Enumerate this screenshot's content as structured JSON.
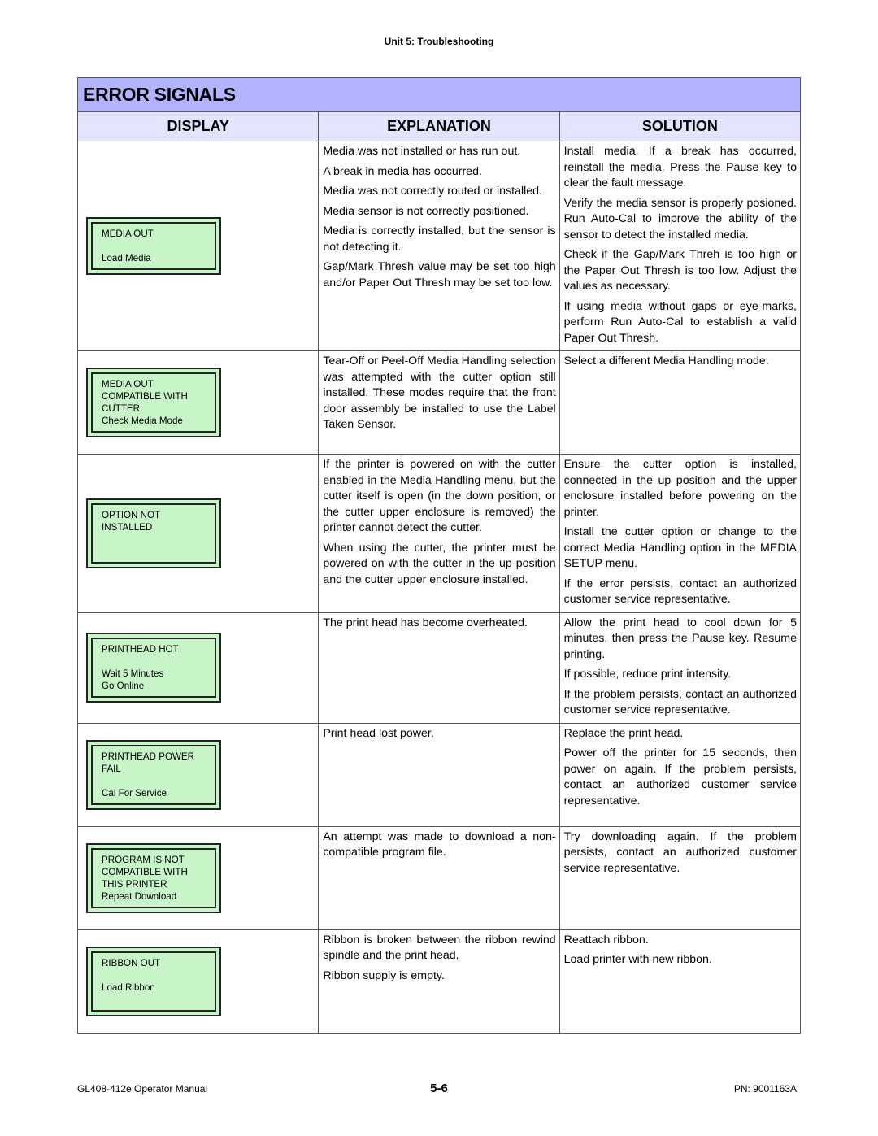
{
  "header": {
    "running_head": "Unit 5:  Troubleshooting"
  },
  "table": {
    "title": "ERROR SIGNALS",
    "columns": {
      "display": "DISPLAY",
      "explanation": "EXPLANATION",
      "solution": "SOLUTION"
    },
    "rows": [
      {
        "display": [
          "MEDIA OUT",
          "",
          "Load Media"
        ],
        "explanation": [
          "Media was not installed or has run out.",
          "A break in media has occurred.",
          "Media was not correctly routed or installed.",
          "Media sensor is not correctly positioned.",
          "Media is correctly installed, but the sensor is not detecting it.",
          "Gap/Mark Thresh value may be set too high and/or Paper Out Thresh may be set too low."
        ],
        "solution": [
          "Install media. If a break has occurred, reinstall the media. Press the Pause key to clear the fault message.",
          "Verify the media sensor is properly posioned. Run Auto-Cal to improve the ability of the sensor to detect the installed media.",
          "Check if the Gap/Mark Threh is too high or the Paper Out Thresh is too low. Adjust the values as necessary.",
          "If using media without gaps or eye-marks, perform Run Auto-Cal to establish a valid Paper Out Thresh."
        ]
      },
      {
        "display": [
          "MEDIA OUT",
          "COMPATIBLE WITH",
          "CUTTER",
          "Check Media Mode"
        ],
        "explanation": [
          "Tear-Off or Peel-Off Media Handling selection was attempted with the cutter option still installed. These modes require that the front door assembly be installed to use the Label Taken Sensor."
        ],
        "solution": [
          "Select a different Media Handling mode."
        ]
      },
      {
        "display": [
          "OPTION NOT",
          "INSTALLED",
          "",
          ""
        ],
        "explanation": [
          "If the printer is powered on with the cutter enabled in the Media Handling menu, but the cutter itself is open (in the down position, or the cutter upper enclosure is removed) the printer cannot detect the cutter.",
          "When using the cutter, the printer must be powered on with the cutter in the up position and the cutter upper enclosure installed."
        ],
        "solution": [
          "Ensure the cutter option is installed, connected in the up position and the upper enclosure installed before powering on the printer.",
          "Install the cutter option or change to the correct Media Handling option in the MEDIA SETUP menu.",
          "If the error persists, contact an authorized customer service representative."
        ]
      },
      {
        "display": [
          "PRINTHEAD HOT",
          "",
          "Wait 5 Minutes",
          "Go Online"
        ],
        "explanation": [
          "The print head has become overheated."
        ],
        "solution": [
          "Allow the print head to cool down for 5 minutes, then press the Pause key. Resume printing.",
          "If possible, reduce print intensity.",
          "If the problem persists, contact an authorized customer service representative."
        ]
      },
      {
        "display": [
          "PRINTHEAD POWER",
          "FAIL",
          "",
          "Cal For Service"
        ],
        "explanation": [
          "Print head lost power."
        ],
        "solution": [
          "Replace the print head.",
          "Power off the printer for 15 seconds, then power on again. If the problem persists, contact an authorized customer service representative."
        ]
      },
      {
        "display": [
          "PROGRAM IS NOT",
          "COMPATIBLE WITH",
          "THIS PRINTER",
          "Repeat Download"
        ],
        "explanation": [
          "An attempt was made to download a non-compatible program file."
        ],
        "solution": [
          "Try downloading again. If the problem persists, contact an authorized customer service representative."
        ]
      },
      {
        "display": [
          "RIBBON OUT",
          "",
          "Load Ribbon",
          ""
        ],
        "explanation": [
          "Ribbon is broken between the ribbon rewind spindle and the print head.",
          "Ribbon supply is empty."
        ],
        "solution": [
          "Reattach ribbon.",
          "Load printer with new ribbon."
        ]
      }
    ]
  },
  "footer": {
    "manual": "GL408-412e Operator Manual",
    "page": "5-6",
    "part_number": "PN: 9001163A"
  },
  "colors": {
    "title_bg": "#b3b3ff",
    "column_header_bg": "#e4e4ff",
    "lcd_bg": "#c8f5c8"
  }
}
